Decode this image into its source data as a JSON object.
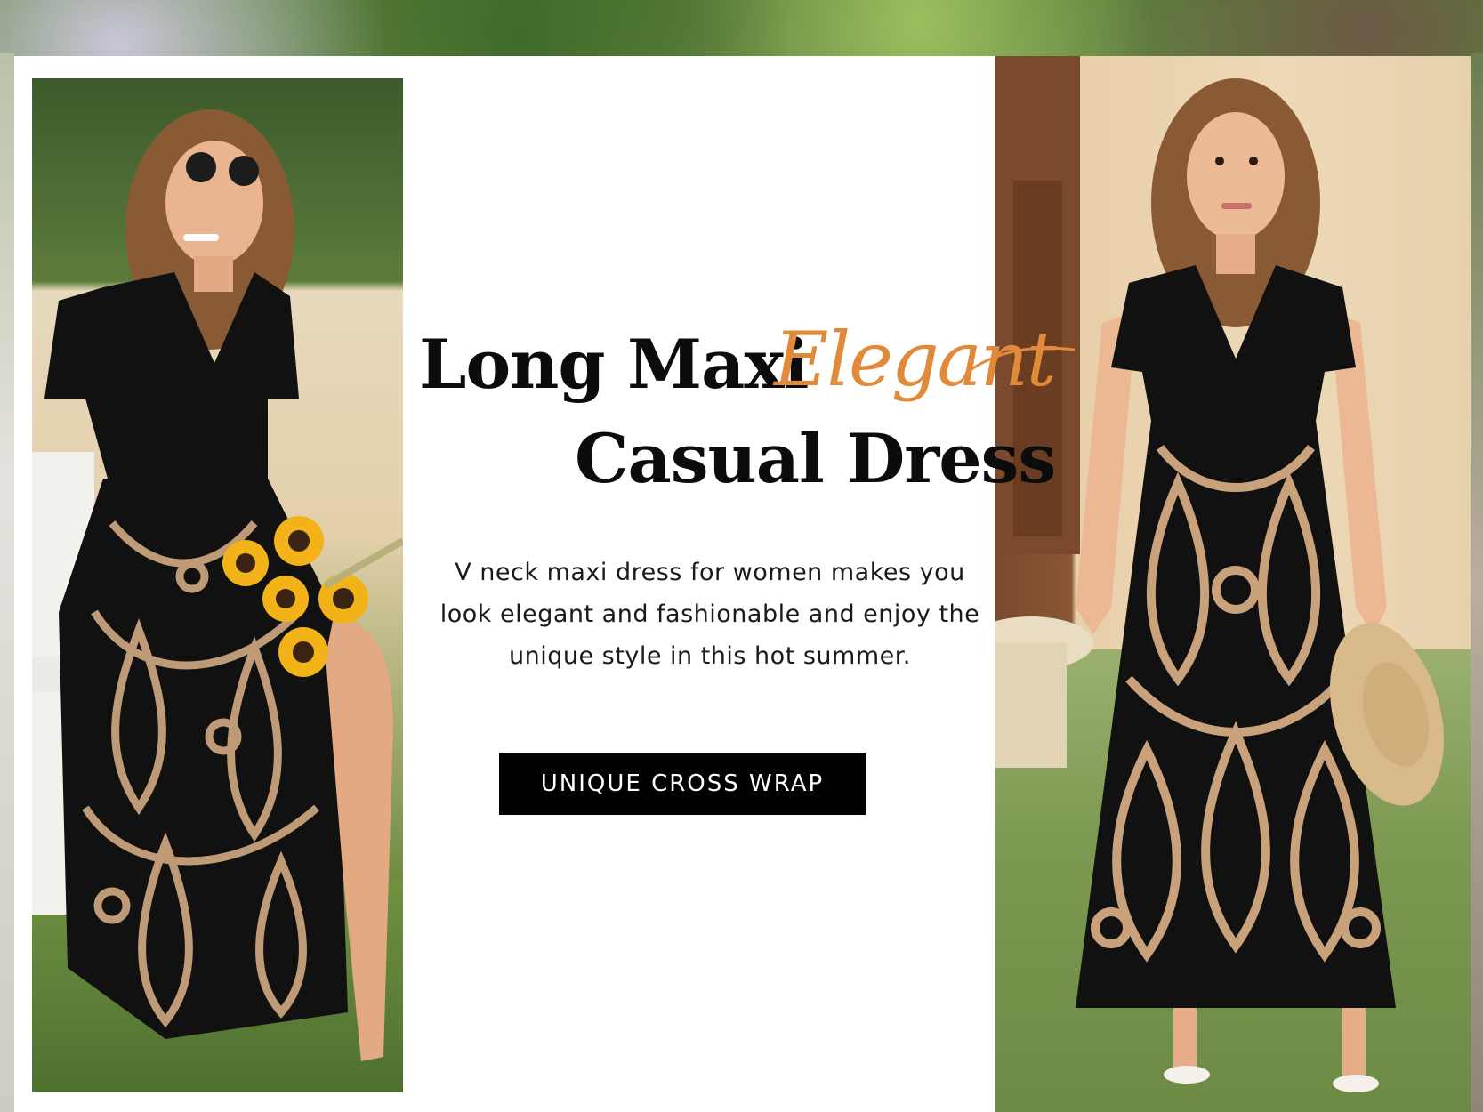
{
  "banner": {
    "headline_line1": "Long Maxi",
    "headline_script": "Elegant",
    "headline_line2": "Casual Dress",
    "description": "V neck maxi dress for women makes you look elegant and fashionable and enjoy the unique style in this hot summer.",
    "cta_label": "UNIQUE CROSS WRAP"
  },
  "colors": {
    "script_accent": "#e08a3a",
    "cta_background": "#000000",
    "cta_text": "#ffffff",
    "dress_pattern_tan": "#c9a27c",
    "dress_black": "#111111"
  }
}
